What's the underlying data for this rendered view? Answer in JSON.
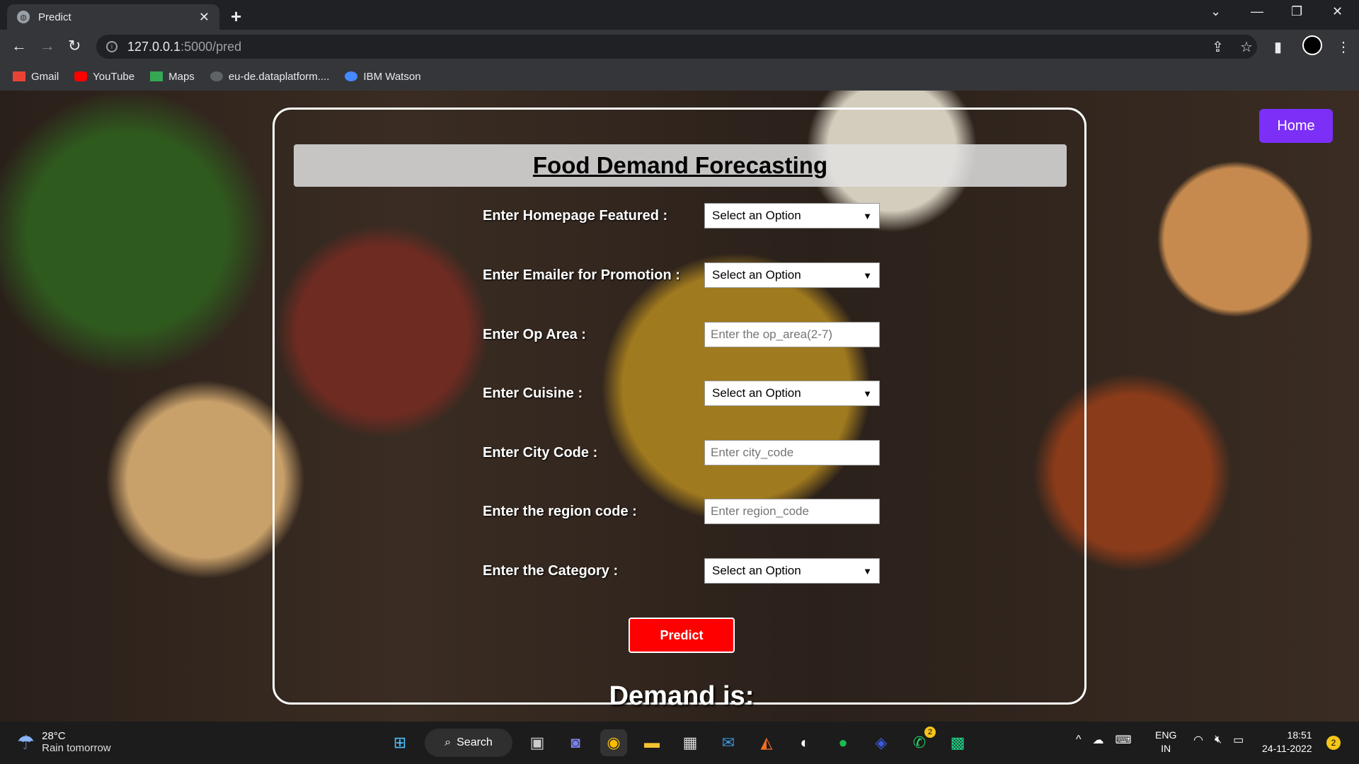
{
  "browser": {
    "tab_title": "Predict",
    "url_host": "127.0.0.1",
    "url_path": ":5000/pred",
    "bookmarks": [
      {
        "label": "Gmail",
        "icon": "gmail-icon",
        "color": "#ea4335"
      },
      {
        "label": "YouTube",
        "icon": "youtube-icon",
        "color": "#ff0000"
      },
      {
        "label": "Maps",
        "icon": "maps-icon",
        "color": "#34a853"
      },
      {
        "label": "eu-de.dataplatform....",
        "icon": "dataplatform-icon",
        "color": "#9aa0a6"
      },
      {
        "label": "IBM Watson",
        "icon": "watson-icon",
        "color": "#4589ff"
      }
    ]
  },
  "page": {
    "title": "Food Demand Forecasting",
    "home_label": "Home",
    "form": {
      "homepage_featured_label": "Enter Homepage Featured :",
      "emailer_label": "Enter Emailer for Promotion :",
      "op_area_label": "Enter Op Area :",
      "cuisine_label": "Enter Cuisine :",
      "city_code_label": "Enter City Code :",
      "region_code_label": "Enter the region code :",
      "category_label": "Enter the Category :",
      "select_placeholder": "Select an Option",
      "op_area_placeholder": "Enter the op_area(2-7)",
      "city_code_placeholder": "Enter city_code",
      "region_code_placeholder": "Enter region_code",
      "predict_label": "Predict"
    },
    "result_label": "Demand is:"
  },
  "taskbar": {
    "temperature": "28°C",
    "weather_text": "Rain tomorrow",
    "search_label": "Search",
    "whatsapp_badge": "2",
    "lang_line1": "ENG",
    "lang_line2": "IN",
    "time": "18:51",
    "date": "24-11-2022",
    "notification_count": "2"
  },
  "colors": {
    "predict_button": "#ff0000",
    "home_button": "#7b2ff7"
  }
}
